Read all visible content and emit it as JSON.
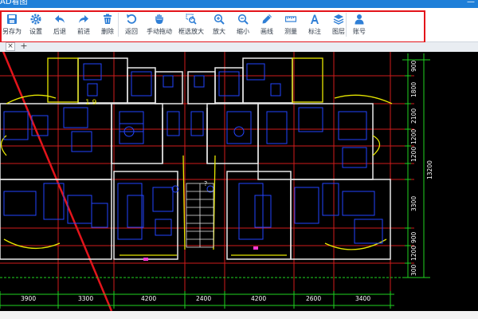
{
  "window": {
    "title": "AD看图",
    "minimize_glyph": "—"
  },
  "toolbar": {
    "group1": [
      {
        "label": "另存为",
        "icon": "save-as-icon"
      },
      {
        "label": "设置",
        "icon": "gear-icon"
      },
      {
        "label": "后退",
        "icon": "back-arrow-icon"
      },
      {
        "label": "前进",
        "icon": "forward-arrow-icon"
      },
      {
        "label": "删除",
        "icon": "trash-icon"
      }
    ],
    "group2": [
      {
        "label": "返回",
        "icon": "return-icon"
      },
      {
        "label": "手动拖动",
        "icon": "hand-icon"
      },
      {
        "label": "框选放大",
        "icon": "box-zoom-icon"
      },
      {
        "label": "放大",
        "icon": "zoom-in-icon"
      },
      {
        "label": "缩小",
        "icon": "zoom-out-icon"
      },
      {
        "label": "画线",
        "icon": "pen-icon"
      },
      {
        "label": "测量",
        "icon": "ruler-icon"
      },
      {
        "label": "标注",
        "icon": "annotate-icon"
      },
      {
        "label": "图层",
        "icon": "layers-icon"
      }
    ],
    "group3": [
      {
        "label": "账号",
        "icon": "user-icon"
      }
    ],
    "accent_color": "#2f7fd6",
    "highlight_color": "#e3141b"
  },
  "tabs": {
    "close_glyph": "×",
    "add_glyph": "+"
  },
  "drawing": {
    "bottom_dims": [
      "3900",
      "3300",
      "4200",
      "2400",
      "4200",
      "2600",
      "3400"
    ],
    "right_dims": [
      "900",
      "1800",
      "2100",
      "1200",
      "1200",
      "3300",
      "900",
      "1200",
      "300"
    ],
    "right_total": "13200",
    "stair_label": "?",
    "overall_label": "1 9"
  }
}
